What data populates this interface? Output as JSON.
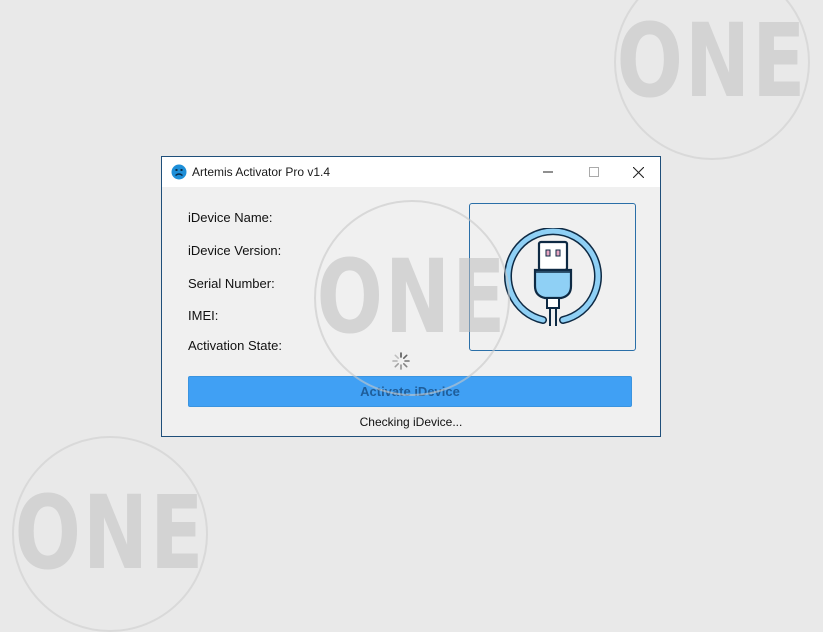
{
  "watermark": {
    "text": "ONE"
  },
  "window": {
    "title": "Artemis Activator Pro v1.4",
    "icon": "sad-face-icon"
  },
  "fields": {
    "device_name_label": "iDevice Name:",
    "device_version_label": "iDevice Version:",
    "serial_label": "Serial Number:",
    "imei_label": "IMEI:",
    "activation_state_label": "Activation State:"
  },
  "device_panel": {
    "icon": "usb-cable-icon"
  },
  "actions": {
    "activate_label": "Activate iDevice"
  },
  "status": {
    "text": "Checking iDevice..."
  },
  "colors": {
    "accent": "#40a0f4",
    "window_border": "#1f4f7a",
    "panel_border": "#2a6fa8",
    "usb_light_blue": "#8fd0f5"
  }
}
